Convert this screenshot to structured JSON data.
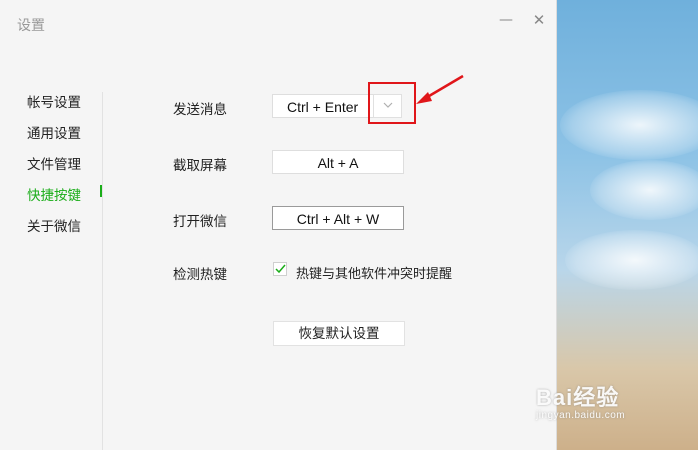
{
  "window": {
    "title": "设置",
    "minimize_icon": "minimize-icon",
    "close_icon": "close-icon"
  },
  "sidebar": {
    "items": [
      {
        "label": "帐号设置",
        "active": false
      },
      {
        "label": "通用设置",
        "active": false
      },
      {
        "label": "文件管理",
        "active": false
      },
      {
        "label": "快捷按键",
        "active": true
      },
      {
        "label": "关于微信",
        "active": false
      }
    ]
  },
  "shortcuts": {
    "send_message": {
      "label": "发送消息",
      "value": "Ctrl + Enter",
      "dropdown_icon": "chevron-down-icon"
    },
    "screenshot": {
      "label": "截取屏幕",
      "value": "Alt + A"
    },
    "open_wechat": {
      "label": "打开微信",
      "value": "Ctrl + Alt + W"
    },
    "detect_hotkey": {
      "label": "检测热键",
      "checkbox_label": "热键与其他软件冲突时提醒",
      "checked": true
    }
  },
  "reset_button": "恢复默认设置",
  "watermark": {
    "main": "Bai经验",
    "sub": "jingyan.baidu.com"
  },
  "colors": {
    "accent": "#1aad19",
    "annotation": "#e0161a"
  }
}
